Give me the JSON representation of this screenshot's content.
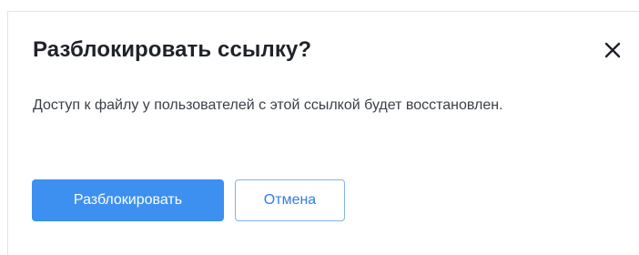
{
  "dialog": {
    "title": "Разблокировать ссылку?",
    "message": "Доступ к файлу у пользователей с этой ссылкой будет восстановлен.",
    "close_icon": "close-icon",
    "confirm_label": "Разблокировать",
    "cancel_label": "Отмена"
  },
  "colors": {
    "primary": "#3d8ff0",
    "secondary_text": "#2f7ee6",
    "title_text": "#1f2329",
    "body_text": "#3a3f47"
  }
}
